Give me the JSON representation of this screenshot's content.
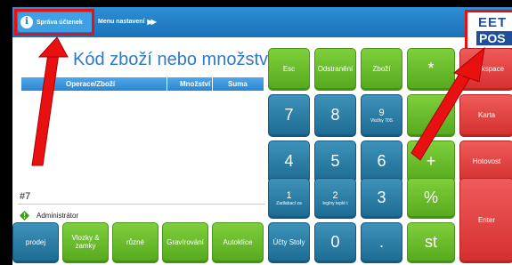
{
  "topbar": {
    "active_tab": "Správa účtenek",
    "second_tab": "Menu nastavení",
    "second_tab_icon": "fast-forward-icon"
  },
  "logo": {
    "line1": "EET",
    "line2": "POS"
  },
  "order_panel": {
    "title": "Kód zboží nebo množství",
    "columns": [
      "Operace/Zboží",
      "Množství",
      "Suma"
    ],
    "order_number": "#7",
    "user": "Administrátor"
  },
  "keypad": {
    "esc": "Esc",
    "remove": "Odstranění",
    "goods": "Zboží",
    "multiply": "*",
    "backspace": "Backspace",
    "seven": "7",
    "eight": "8",
    "nine": "9",
    "nine_sub": "Vložky 70S",
    "karta": "Karta",
    "four": "4",
    "five": "5",
    "six": "6",
    "plus": "+",
    "hotovost": "Hotovost",
    "one": "1",
    "one_sub": "Zadlabací za",
    "two": "2",
    "two_sub": "legíny teplé t",
    "three": "3",
    "percent": "%",
    "enter": "Enter",
    "zero": "0",
    "dot": ".",
    "st": "st"
  },
  "bottom_bar": {
    "prodej": "prodej",
    "vlozky": "Vlozky & zamky",
    "ruzne": "různé",
    "gravirovani": "Gravírování",
    "autoklice": "Autoklíce",
    "ucty": "Účty Stoly"
  },
  "colors": {
    "annotation": "#e81010",
    "topbar": "#1a72b8",
    "green_button": "#64b82a",
    "blue_button": "#2a7ea6",
    "red_button": "#e04444"
  }
}
